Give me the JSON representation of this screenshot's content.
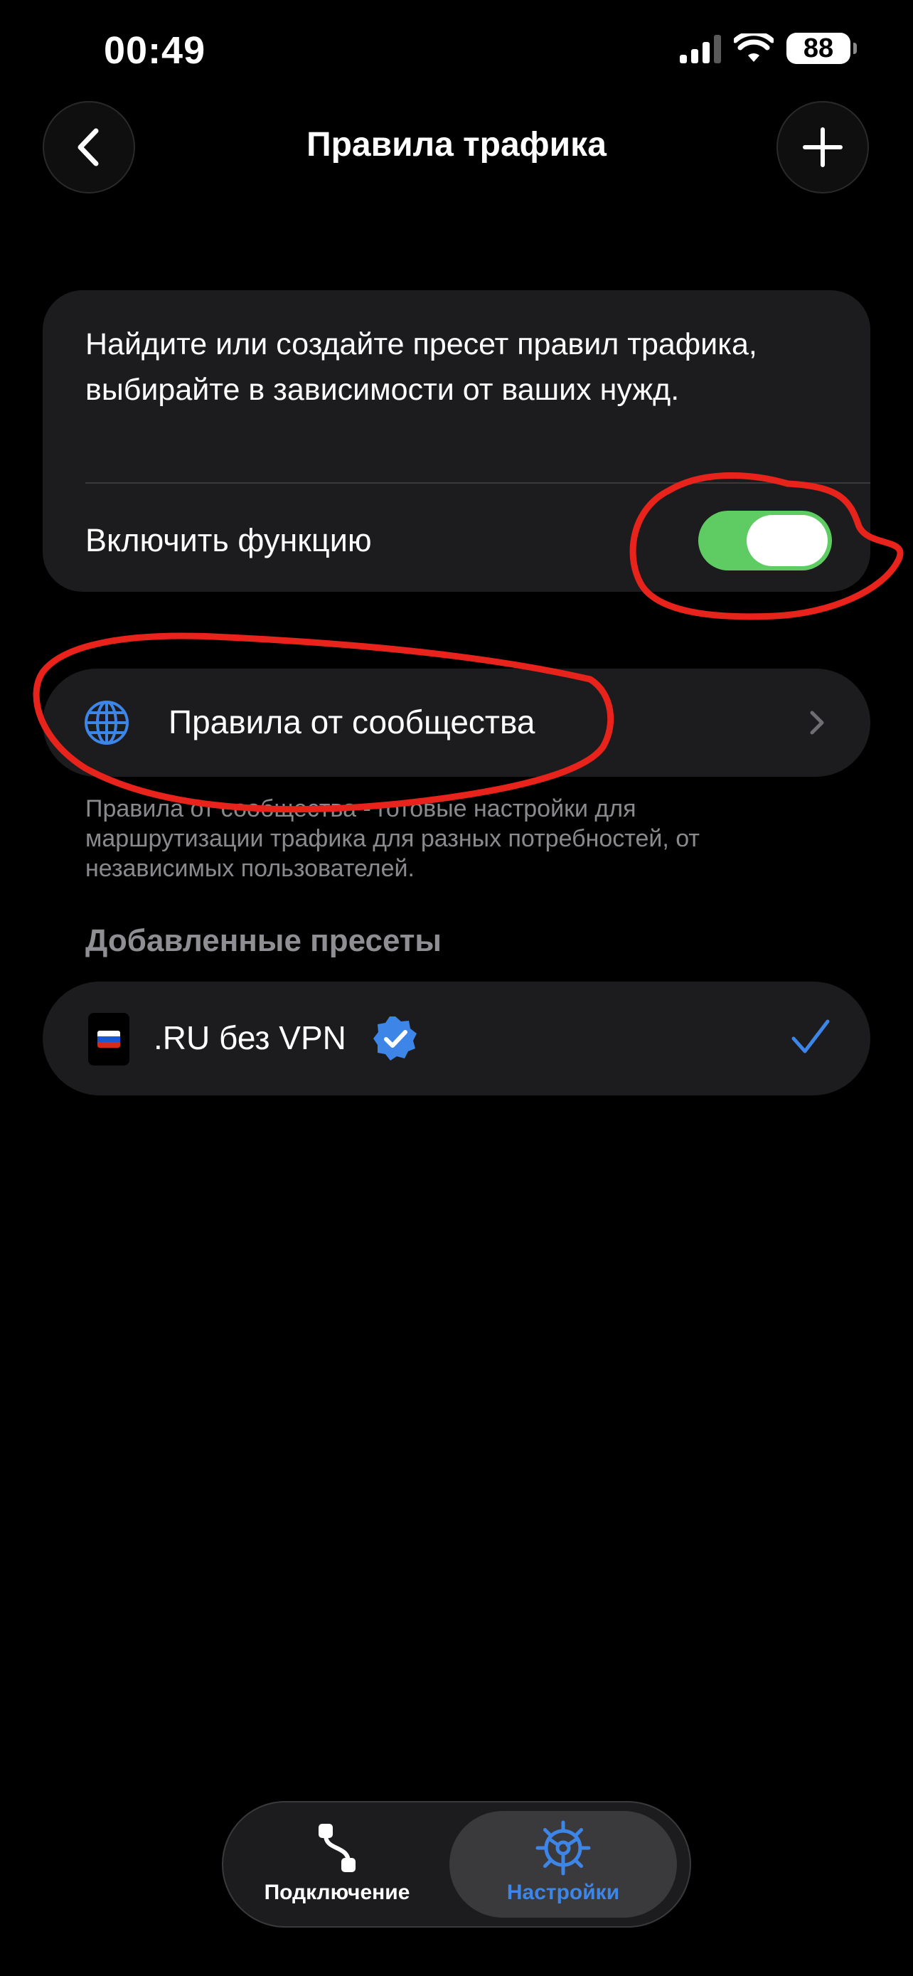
{
  "status_bar": {
    "time": "00:49",
    "battery": "88",
    "icons": [
      "signal-icon",
      "wifi-icon",
      "battery-icon"
    ]
  },
  "header": {
    "title": "Правила трафика",
    "back_icon": "chevron-left-icon",
    "add_icon": "plus-icon"
  },
  "info_card": {
    "description": "Найдите или создайте пресет правил трафика, выбирайте в зависимости от ваших нужд.",
    "toggle_label": "Включить функцию",
    "toggle_on": true
  },
  "community": {
    "label": "Правила от сообщества",
    "icon": "globe-icon",
    "description": "Правила от сообщества - готовые настройки для маршрутизации трафика для разных потребностей, от независимых пользователей."
  },
  "presets": {
    "heading": "Добавленные пресеты",
    "items": [
      {
        "label": ".RU без VPN",
        "icon": "russia-flag-icon",
        "verified": true,
        "selected": true
      }
    ]
  },
  "tab_bar": {
    "tabs": [
      {
        "label": "Подключение",
        "icon": "route-icon",
        "active": false
      },
      {
        "label": "Настройки",
        "icon": "gear-icon",
        "active": true
      }
    ]
  },
  "colors": {
    "background": "#000000",
    "card": "#1c1c1e",
    "toggle_on": "#5ecc62",
    "accent": "#3d86e8",
    "secondary_text": "#8e8e93",
    "annotation": "#e8231c"
  }
}
